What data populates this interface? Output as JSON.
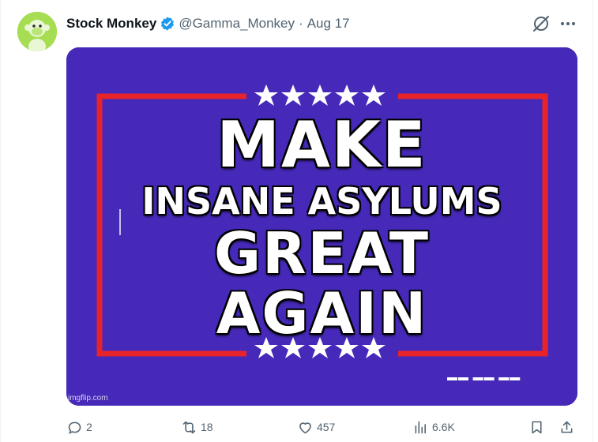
{
  "tweet": {
    "display_name": "Stock Monkey",
    "handle": "@Gamma_Monkey",
    "separator": "·",
    "date": "Aug 17",
    "verified": true,
    "accent_color": "#1d9bf0"
  },
  "media": {
    "line1": "MAKE",
    "line2": "INSANE ASYLUMS",
    "line3": "GREAT",
    "line4": "AGAIN",
    "watermark": "imgflip.com",
    "background_color": "#4629b8",
    "border_color": "#e8242a",
    "star_count_top": 5,
    "star_count_bottom": 5
  },
  "actions": {
    "replies": "2",
    "reposts": "18",
    "likes": "457",
    "views": "6.6K"
  },
  "icons": {
    "verified": "verified-badge-icon",
    "grok": "grok-icon",
    "more": "more-icon",
    "reply": "reply-icon",
    "repost": "repost-icon",
    "like": "like-icon",
    "views": "views-icon",
    "bookmark": "bookmark-icon",
    "share": "share-icon"
  }
}
